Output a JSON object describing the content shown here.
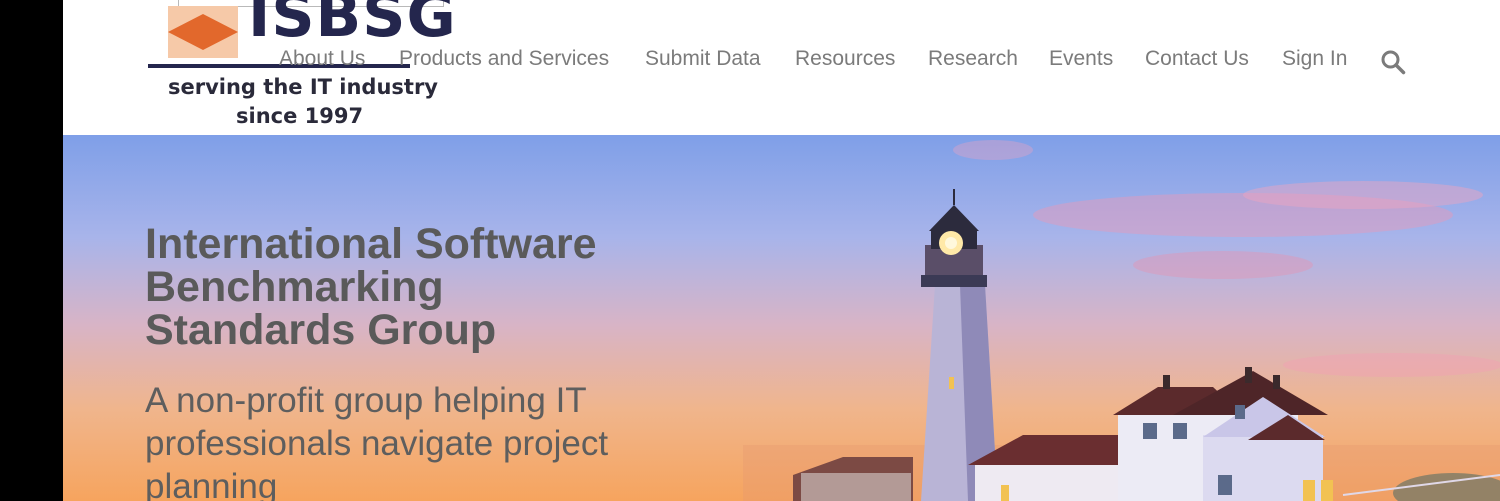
{
  "logo": {
    "name": "ISBSG",
    "tagline_line1": "serving the IT industry",
    "tagline_line2": "since 1997"
  },
  "nav": {
    "items": [
      {
        "label": "About Us"
      },
      {
        "label": "Products and Services"
      },
      {
        "label": "Submit Data"
      },
      {
        "label": "Resources"
      },
      {
        "label": "Research"
      },
      {
        "label": "Events"
      },
      {
        "label": "Contact Us"
      },
      {
        "label": "Sign In"
      }
    ],
    "search_icon": "search-icon"
  },
  "hero": {
    "title": "International Software Benchmarking Standards Group",
    "subtitle": "A non-profit group helping IT professionals navigate project planning"
  },
  "colors": {
    "brand_navy": "#24264d",
    "logo_orange": "#e8753a",
    "nav_text": "#7b7b7b",
    "hero_text": "#5a5a5a"
  }
}
